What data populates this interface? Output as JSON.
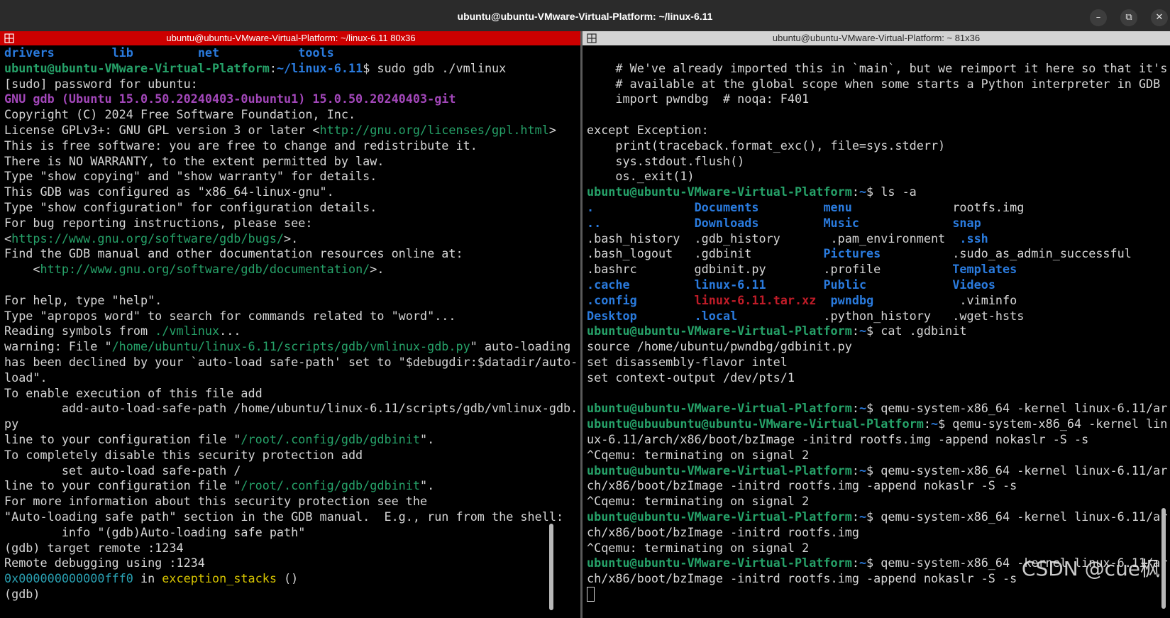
{
  "window": {
    "title": "ubuntu@ubuntu-VMware-Virtual-Platform: ~/linux-6.11",
    "buttons": {
      "minimize": "–",
      "maximize": "⧉",
      "close": "✕"
    }
  },
  "left_pane": {
    "title": "ubuntu@ubuntu-VMware-Virtual-Platform: ~/linux-6.11 80x36",
    "lines": [
      [
        [
          "drivers",
          "bl"
        ],
        [
          "        ",
          ""
        ],
        [
          "lib",
          "bl"
        ],
        [
          "         ",
          ""
        ],
        [
          "net",
          "bl"
        ],
        [
          "           ",
          ""
        ],
        [
          "tools",
          "bl"
        ]
      ],
      [
        [
          "ubuntu@ubuntu-VMware-Virtual-Platform",
          "ug"
        ],
        [
          ":",
          ""
        ],
        [
          "~/linux-6.11",
          "pth"
        ],
        [
          "$ sudo gdb ./vmlinux",
          ""
        ]
      ],
      [
        [
          "[sudo] password for ubuntu:",
          ""
        ]
      ],
      [
        [
          "GNU gdb (Ubuntu 15.0.50.20240403-0ubuntu1) 15.0.50.20240403-git",
          "mg"
        ]
      ],
      [
        [
          "Copyright (C) 2024 Free Software Foundation, Inc.",
          ""
        ]
      ],
      [
        [
          "License GPLv3+: GNU GPL version 3 or later <",
          ""
        ],
        [
          "http://gnu.org/licenses/gpl.html",
          "gr"
        ],
        [
          ">",
          ""
        ]
      ],
      [
        [
          "This is free software: you are free to change and redistribute it.",
          ""
        ]
      ],
      [
        [
          "There is NO WARRANTY, to the extent permitted by law.",
          ""
        ]
      ],
      [
        [
          "Type \"show copying\" and \"show warranty\" for details.",
          ""
        ]
      ],
      [
        [
          "This GDB was configured as \"x86_64-linux-gnu\".",
          ""
        ]
      ],
      [
        [
          "Type \"show configuration\" for configuration details.",
          ""
        ]
      ],
      [
        [
          "For bug reporting instructions, please see:",
          ""
        ]
      ],
      [
        [
          "<",
          ""
        ],
        [
          "https://www.gnu.org/software/gdb/bugs/",
          "gr"
        ],
        [
          ">.",
          ""
        ]
      ],
      [
        [
          "Find the GDB manual and other documentation resources online at:",
          ""
        ]
      ],
      [
        [
          "    <",
          ""
        ],
        [
          "http://www.gnu.org/software/gdb/documentation/",
          "gr"
        ],
        [
          ">.",
          ""
        ]
      ],
      [
        [
          "",
          ""
        ]
      ],
      [
        [
          "For help, type \"help\".",
          ""
        ]
      ],
      [
        [
          "Type \"apropos word\" to search for commands related to \"word\"...",
          ""
        ]
      ],
      [
        [
          "Reading symbols from ",
          ""
        ],
        [
          "./vmlinux",
          "gr"
        ],
        [
          "...",
          ""
        ]
      ],
      [
        [
          "warning: File \"",
          ""
        ],
        [
          "/home/ubuntu/linux-6.11/scripts/gdb/vmlinux-gdb.py",
          "gr"
        ],
        [
          "\" auto-loading",
          ""
        ]
      ],
      [
        [
          "has been declined by your `auto-load safe-path' set to \"$debugdir:$datadir/auto-",
          ""
        ]
      ],
      [
        [
          "load\".",
          ""
        ]
      ],
      [
        [
          "To enable execution of this file add",
          ""
        ]
      ],
      [
        [
          "        add-auto-load-safe-path /home/ubuntu/linux-6.11/scripts/gdb/vmlinux-gdb.",
          ""
        ]
      ],
      [
        [
          "py",
          ""
        ]
      ],
      [
        [
          "line to your configuration file \"",
          ""
        ],
        [
          "/root/.config/gdb/gdbinit",
          "gr"
        ],
        [
          "\".",
          ""
        ]
      ],
      [
        [
          "To completely disable this security protection add",
          ""
        ]
      ],
      [
        [
          "        set auto-load safe-path /",
          ""
        ]
      ],
      [
        [
          "line to your configuration file \"",
          ""
        ],
        [
          "/root/.config/gdb/gdbinit",
          "gr"
        ],
        [
          "\".",
          ""
        ]
      ],
      [
        [
          "For more information about this security protection see the",
          ""
        ]
      ],
      [
        [
          "\"Auto-loading safe path\" section in the GDB manual.  E.g., run from the shell:",
          ""
        ]
      ],
      [
        [
          "        info \"(gdb)Auto-loading safe path\"",
          ""
        ]
      ],
      [
        [
          "(gdb) target remote :1234",
          ""
        ]
      ],
      [
        [
          "Remote debugging using :1234",
          ""
        ]
      ],
      [
        [
          "0x000000000000fff0",
          "cy"
        ],
        [
          " in ",
          ""
        ],
        [
          "exception_stacks",
          "ye"
        ],
        [
          " ()",
          ""
        ]
      ],
      [
        [
          "(gdb) ",
          ""
        ]
      ]
    ]
  },
  "right_pane": {
    "title": "ubuntu@ubuntu-VMware-Virtual-Platform: ~ 81x36",
    "lines": [
      [
        [
          "",
          ""
        ]
      ],
      [
        [
          "    # We've already imported this in `main`, but we reimport it here so that it's",
          ""
        ]
      ],
      [
        [
          "    # available at the global scope when some starts a Python interpreter in GDB",
          ""
        ]
      ],
      [
        [
          "    import pwndbg  # noqa: F401",
          ""
        ]
      ],
      [
        [
          "",
          ""
        ]
      ],
      [
        [
          "except Exception:",
          ""
        ]
      ],
      [
        [
          "    print(traceback.format_exc(), file=sys.stderr)",
          ""
        ]
      ],
      [
        [
          "    sys.stdout.flush()",
          ""
        ]
      ],
      [
        [
          "    os._exit(1)",
          ""
        ]
      ],
      [
        [
          "ubuntu@ubuntu-VMware-Virtual-Platform",
          "ug"
        ],
        [
          ":",
          ""
        ],
        [
          "~",
          "pth"
        ],
        [
          "$ ls -a",
          ""
        ]
      ],
      [
        [
          ".",
          "bl"
        ],
        [
          "              ",
          ""
        ],
        [
          "Documents",
          "bl"
        ],
        [
          "         ",
          ""
        ],
        [
          "menu",
          "bl"
        ],
        [
          "              ",
          ""
        ],
        [
          "rootfs.img",
          ""
        ]
      ],
      [
        [
          "..",
          "bl"
        ],
        [
          "             ",
          ""
        ],
        [
          "Downloads",
          "bl"
        ],
        [
          "         ",
          ""
        ],
        [
          "Music",
          "bl"
        ],
        [
          "             ",
          ""
        ],
        [
          "snap",
          "bl"
        ]
      ],
      [
        [
          ".bash_history  .gdb_history       .pam_environment  ",
          ""
        ],
        [
          ".ssh",
          "bl"
        ]
      ],
      [
        [
          ".bash_logout   .gdbinit          ",
          ""
        ],
        [
          "Pictures",
          "bl"
        ],
        [
          "          .sudo_as_admin_successful",
          ""
        ]
      ],
      [
        [
          ".bashrc        gdbinit.py        .profile          ",
          ""
        ],
        [
          "Templates",
          "bl"
        ]
      ],
      [
        [
          ".cache",
          "bl"
        ],
        [
          "         ",
          ""
        ],
        [
          "linux-6.11",
          "bl"
        ],
        [
          "        ",
          ""
        ],
        [
          "Public",
          "bl"
        ],
        [
          "            ",
          ""
        ],
        [
          "Videos",
          "bl"
        ]
      ],
      [
        [
          ".config",
          "bl"
        ],
        [
          "        ",
          ""
        ],
        [
          "linux-6.11.tar.xz",
          "rd"
        ],
        [
          "  ",
          ""
        ],
        [
          "pwndbg",
          "bl"
        ],
        [
          "            .viminfo",
          ""
        ]
      ],
      [
        [
          "Desktop",
          "bl"
        ],
        [
          "        ",
          ""
        ],
        [
          ".local",
          "bl"
        ],
        [
          "            .python_history   .wget-hsts",
          ""
        ]
      ],
      [
        [
          "ubuntu@ubuntu-VMware-Virtual-Platform",
          "ug"
        ],
        [
          ":",
          ""
        ],
        [
          "~",
          "pth"
        ],
        [
          "$ cat .gdbinit",
          ""
        ]
      ],
      [
        [
          "source /home/ubuntu/pwndbg/gdbinit.py",
          ""
        ]
      ],
      [
        [
          "set disassembly-flavor intel",
          ""
        ]
      ],
      [
        [
          "set context-output /dev/pts/1",
          ""
        ]
      ],
      [
        [
          "",
          ""
        ]
      ],
      [
        [
          "ubuntu@ubuntu-VMware-Virtual-Platform",
          "ug"
        ],
        [
          ":",
          ""
        ],
        [
          "~",
          "pth"
        ],
        [
          "$ qemu-system-x86_64 -kernel linux-6.11/ar",
          ""
        ]
      ],
      [
        [
          "ubuntu@ubuubuntu@ubuntu-VMware-Virtual-Platform",
          "ug"
        ],
        [
          ":",
          ""
        ],
        [
          "~",
          "pth"
        ],
        [
          "$ qemu-system-x86_64 -kernel lin",
          ""
        ]
      ],
      [
        [
          "ux-6.11/arch/x86/boot/bzImage -initrd rootfs.img -append nokaslr -S -s",
          ""
        ]
      ],
      [
        [
          "^Cqemu: terminating on signal 2",
          ""
        ]
      ],
      [
        [
          "ubuntu@ubuntu-VMware-Virtual-Platform",
          "ug"
        ],
        [
          ":",
          ""
        ],
        [
          "~",
          "pth"
        ],
        [
          "$ qemu-system-x86_64 -kernel linux-6.11/ar",
          ""
        ]
      ],
      [
        [
          "ch/x86/boot/bzImage -initrd rootfs.img -append nokaslr -S -s",
          ""
        ]
      ],
      [
        [
          "^Cqemu: terminating on signal 2",
          ""
        ]
      ],
      [
        [
          "ubuntu@ubuntu-VMware-Virtual-Platform",
          "ug"
        ],
        [
          ":",
          ""
        ],
        [
          "~",
          "pth"
        ],
        [
          "$ qemu-system-x86_64 -kernel linux-6.11/ar",
          ""
        ]
      ],
      [
        [
          "ch/x86/boot/bzImage -initrd rootfs.img",
          ""
        ]
      ],
      [
        [
          "^Cqemu: terminating on signal 2",
          ""
        ]
      ],
      [
        [
          "ubuntu@ubuntu-VMware-Virtual-Platform",
          "ug"
        ],
        [
          ":",
          ""
        ],
        [
          "~",
          "pth"
        ],
        [
          "$ qemu-system-x86_64 -kernel linux-6.11/ar",
          ""
        ]
      ],
      [
        [
          "ch/x86/boot/bzImage -initrd rootfs.img -append nokaslr -S -s",
          ""
        ]
      ],
      [
        [
          "",
          "cursor"
        ]
      ]
    ]
  },
  "watermark": "CSDN @cue枫",
  "colors": {
    "prompt_user": "#26a269",
    "prompt_path": "#2a7bde",
    "directory": "#2a7bde",
    "archive": "#c01c28",
    "gdb_banner": "#a347ba",
    "link": "#26a269",
    "active_pane_bar": "#cc0000",
    "inactive_pane_bar": "#d3d3d3"
  }
}
